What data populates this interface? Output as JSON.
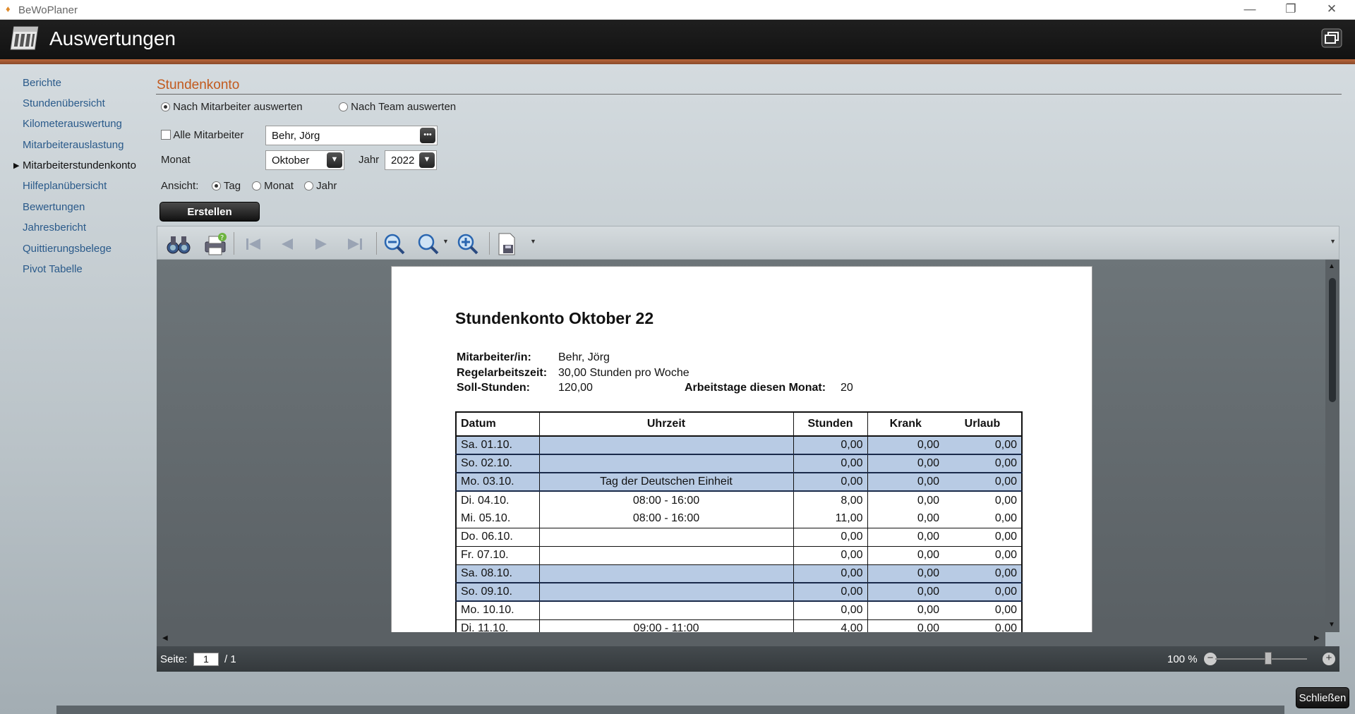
{
  "window": {
    "title": "BeWoPlaner"
  },
  "header": {
    "title": "Auswertungen"
  },
  "sidebar": {
    "items": [
      {
        "label": "Berichte"
      },
      {
        "label": "Stundenübersicht"
      },
      {
        "label": "Kilometerauswertung"
      },
      {
        "label": "Mitarbeiterauslastung"
      },
      {
        "label": "Mitarbeiterstundenkonto",
        "active": true
      },
      {
        "label": "Hilfeplanübersicht"
      },
      {
        "label": "Bewertungen"
      },
      {
        "label": "Jahresbericht"
      },
      {
        "label": "Quittierungsbelege"
      },
      {
        "label": "Pivot Tabelle"
      }
    ]
  },
  "form": {
    "section_title": "Stundenkonto",
    "mode_employee": "Nach Mitarbeiter auswerten",
    "mode_team": "Nach Team auswerten",
    "all_employees": "Alle Mitarbeiter",
    "employee_value": "Behr, Jörg",
    "month_label": "Monat",
    "month_value": "Oktober",
    "year_label": "Jahr",
    "year_value": "2022",
    "view_label": "Ansicht:",
    "view_day": "Tag",
    "view_month": "Monat",
    "view_year": "Jahr",
    "create_button": "Erstellen",
    "close_button": "Schließen"
  },
  "report": {
    "title": "Stundenkonto Oktober 22",
    "employee_label": "Mitarbeiter/in:",
    "employee_value": "Behr, Jörg",
    "regular_label": "Regelarbeitszeit:",
    "regular_value": "30,00 Stunden pro Woche",
    "target_label": "Soll-Stunden:",
    "target_value": "120,00",
    "workdays_label": "Arbeitstage diesen Monat:",
    "workdays_value": "20",
    "columns": [
      "Datum",
      "Uhrzeit",
      "Stunden",
      "Krank",
      "Urlaub"
    ],
    "rows": [
      {
        "date": "Sa. 01.10.",
        "time": "",
        "hours": "0,00",
        "sick": "0,00",
        "vac": "0,00",
        "hl": true
      },
      {
        "date": "So. 02.10.",
        "time": "",
        "hours": "0,00",
        "sick": "0,00",
        "vac": "0,00",
        "hl": true
      },
      {
        "date": "Mo. 03.10.",
        "time": "Tag der Deutschen Einheit",
        "hours": "0,00",
        "sick": "0,00",
        "vac": "0,00",
        "hl": true
      },
      {
        "date": "Di. 04.10.",
        "time": "08:00 - 16:00",
        "hours": "8,00",
        "sick": "0,00",
        "vac": "0,00",
        "hl": false,
        "nobottom": true
      },
      {
        "date": "Mi. 05.10.",
        "time": "08:00 - 16:00",
        "hours": "11,00",
        "sick": "0,00",
        "vac": "0,00",
        "hl": false
      },
      {
        "date": "Do. 06.10.",
        "time": "",
        "hours": "0,00",
        "sick": "0,00",
        "vac": "0,00",
        "hl": false
      },
      {
        "date": "Fr. 07.10.",
        "time": "",
        "hours": "0,00",
        "sick": "0,00",
        "vac": "0,00",
        "hl": false
      },
      {
        "date": "Sa. 08.10.",
        "time": "",
        "hours": "0,00",
        "sick": "0,00",
        "vac": "0,00",
        "hl": true
      },
      {
        "date": "So. 09.10.",
        "time": "",
        "hours": "0,00",
        "sick": "0,00",
        "vac": "0,00",
        "hl": true
      },
      {
        "date": "Mo. 10.10.",
        "time": "",
        "hours": "0,00",
        "sick": "0,00",
        "vac": "0,00",
        "hl": false
      },
      {
        "date": "Di. 11.10.",
        "time": "09:00 - 11:00",
        "hours": "4,00",
        "sick": "0,00",
        "vac": "0,00",
        "hl": false
      }
    ]
  },
  "statusbar": {
    "page_label": "Seite:",
    "page_value": "1",
    "page_total": "/ 1",
    "zoom": "100 %"
  },
  "colors": {
    "accent": "#c25a1e",
    "header_bg": "#1a1a1a",
    "row_highlight": "#b8cbe4"
  },
  "icons": [
    "binoculars-icon",
    "print-icon",
    "first-page-icon",
    "prev-page-icon",
    "next-page-icon",
    "last-page-icon",
    "zoom-out-icon",
    "zoom-icon",
    "zoom-in-icon",
    "export-icon"
  ]
}
